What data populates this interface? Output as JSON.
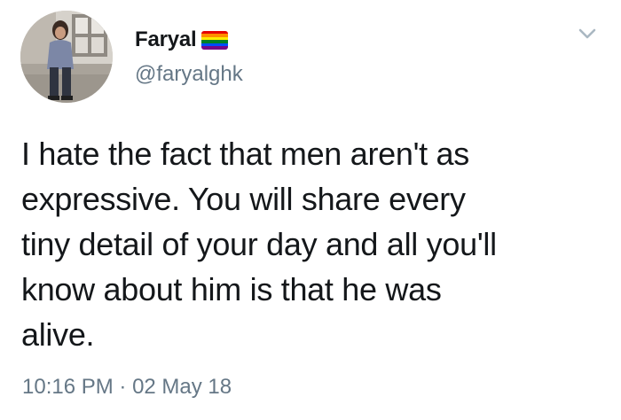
{
  "author": {
    "display_name": "Faryal",
    "handle": "@faryalghk",
    "avatar_icon": "profile-photo-avatar",
    "flag_icon": "rainbow-flag-emoji",
    "flag_colors": [
      "#e40303",
      "#ff8c00",
      "#ffed00",
      "#008026",
      "#004dff",
      "#750787"
    ]
  },
  "menu": {
    "icon": "chevron-down-icon",
    "color": "#aab8c2"
  },
  "tweet": {
    "lines": [
      "I hate the fact that men aren't as",
      "expressive. You will share every",
      "tiny detail of your day and all you'll",
      "know about him is that he was",
      "alive."
    ]
  },
  "meta": {
    "time": "10:16 PM",
    "separator": " · ",
    "date": "02 May 18"
  }
}
